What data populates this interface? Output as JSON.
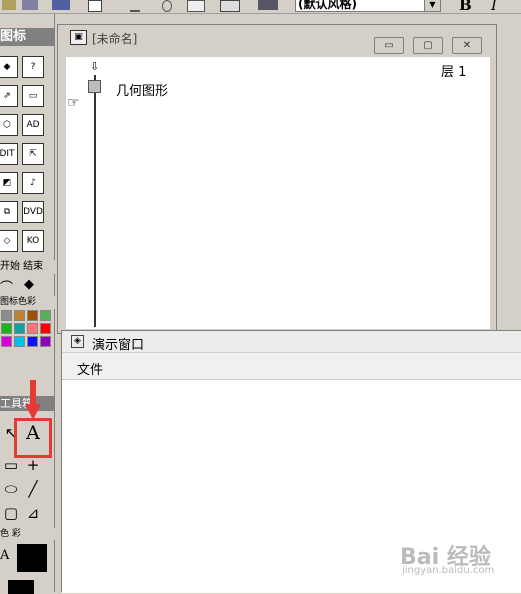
{
  "toolbar": {
    "text_style": "(默认风格)",
    "bold_label": "B",
    "italic_label": "I"
  },
  "palette": {
    "icons_header": "图标",
    "icon_rows": [
      [
        "◆",
        "?"
      ],
      [
        "⇗",
        "▭"
      ],
      [
        "⬡",
        "AD"
      ],
      [
        "DIT",
        "⇱"
      ],
      [
        "◩",
        "♪"
      ],
      [
        "⧉",
        "DVD"
      ],
      [
        "◇",
        "KO"
      ]
    ],
    "flag_header": "开始  结束",
    "color_header": "图标色彩",
    "colors": [
      "#8c8c8c",
      "#c08030",
      "#a05000",
      "#58b058",
      "#18b818",
      "#10a0a0",
      "#f87878",
      "#ff0000",
      "#d800d8",
      "#00c0e8",
      "#1010f8",
      "#9000c0"
    ],
    "tools_header": "工具箱",
    "text_tool_label": "A",
    "color_section_header": "色 彩",
    "fill_label": "A"
  },
  "author_window": {
    "title": "[未命名]",
    "layer_label": "层 1",
    "flowline_item_label": "几何图形",
    "minimize_glyph": "▭",
    "maximize_glyph": "▢",
    "close_glyph": "✕"
  },
  "presentation_window": {
    "title": "演示窗口",
    "menu_file": "文件"
  },
  "watermark": {
    "text": "Bai 经验",
    "url": "jingyan.baidu.com"
  },
  "colors": {
    "highlight": "#e53935",
    "chrome": "#d4d0c8"
  }
}
